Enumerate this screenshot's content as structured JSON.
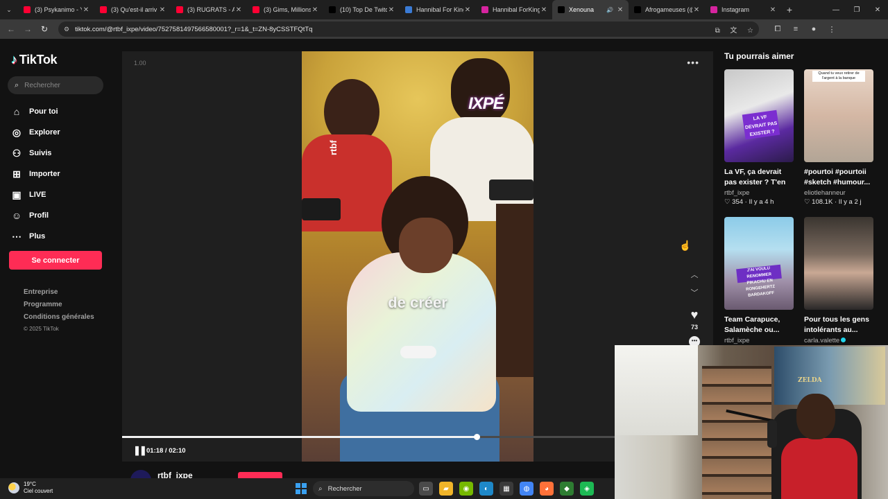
{
  "browser": {
    "tabs": [
      {
        "label": "(3) Psykanimo - Y",
        "icon": "youtube-icon",
        "color": "#ff0033"
      },
      {
        "label": "(3) Qu'est-il arriv",
        "icon": "youtube-icon",
        "color": "#ff0033"
      },
      {
        "label": "(3) RUGRATS - A l",
        "icon": "youtube-icon",
        "color": "#ff0033"
      },
      {
        "label": "(3) Gims, Millions",
        "icon": "youtube-icon",
        "color": "#ff0033"
      },
      {
        "label": "(10) Top De Twitc",
        "icon": "x-icon",
        "color": "#000000"
      },
      {
        "label": "Hannibal For King",
        "icon": "bookmark-icon",
        "color": "#3a7bd5"
      },
      {
        "label": "Hannibal ForKing",
        "icon": "instagram-icon",
        "color": "#d6249f"
      },
      {
        "label": "Xenouna",
        "icon": "tiktok-icon",
        "color": "#000000",
        "active": true
      },
      {
        "label": "Afrogameuses (@",
        "icon": "tiktok-icon",
        "color": "#000000"
      },
      {
        "label": "Instagram",
        "icon": "instagram-icon",
        "color": "#d6249f"
      }
    ],
    "new_tab": "+",
    "url": "tiktok.com/@rtbf_ixpe/video/7527581497566580001?_r=1&_t=ZN-8yCSSTFQtTq"
  },
  "sidebar": {
    "logo": "TikTok",
    "search_placeholder": "Rechercher",
    "nav": [
      {
        "label": "Pour toi",
        "icon": "home-icon"
      },
      {
        "label": "Explorer",
        "icon": "compass-icon"
      },
      {
        "label": "Suivis",
        "icon": "following-icon"
      },
      {
        "label": "Importer",
        "icon": "upload-icon"
      },
      {
        "label": "LIVE",
        "icon": "live-icon"
      },
      {
        "label": "Profil",
        "icon": "profile-icon"
      },
      {
        "label": "Plus",
        "icon": "more-icon"
      }
    ],
    "login_label": "Se connecter",
    "footer": [
      "Entreprise",
      "Programme",
      "Conditions générales"
    ],
    "copyright": "© 2025 TikTok"
  },
  "player": {
    "speed": "1.00",
    "caption": "de créer",
    "watermark_left": "rtbf",
    "watermark_right": "IXPÉ",
    "time": "01:18 / 02:10",
    "progress": 0.6,
    "likes": "73",
    "author": "rtbf_ixpe"
  },
  "suggestions": {
    "title": "Tu pourrais aimer",
    "cards": [
      {
        "title": "La VF, ça devrait pas exister ? T'en pens...",
        "author": "rtbf_ixpe",
        "likes": "354",
        "age": "Il y a 4 h",
        "overlay": "LA VF DEVRAIT PAS EXISTER ?"
      },
      {
        "title": "#pourtoi #pourtoii #sketch #humour...",
        "author": "eliotlehanneur",
        "likes": "108.1K",
        "age": "Il y a 2 j",
        "overlay": "Quand tu veux retirer de l'argent à la banque"
      },
      {
        "title": "Team Carapuce, Salamèche ou...",
        "author": "rtbf_ixpe",
        "overlay": "J'AI VOULU RENOMMER PIKACHU EN RONGEHERTZ BARDAKOFF"
      },
      {
        "title": "Pour tous les gens intolérants au...",
        "author": "carla.valette",
        "verified": true
      }
    ]
  },
  "webcam": {
    "poster_text": "ZELDA"
  },
  "taskbar": {
    "temperature": "19°C",
    "weather": "Ciel couvert",
    "search_placeholder": "Rechercher",
    "apps": [
      {
        "icon": "task-view-icon",
        "color": "#4a4a4a"
      },
      {
        "icon": "file-explorer-icon",
        "color": "#f0b429"
      },
      {
        "icon": "nvidia-icon",
        "color": "#76b900"
      },
      {
        "icon": "edge-icon",
        "color": "#1e88c8"
      },
      {
        "icon": "store-icon",
        "color": "#3a3a3a"
      },
      {
        "icon": "chrome-icon",
        "color": "#4285f4"
      },
      {
        "icon": "firefox-icon",
        "color": "#ff7139"
      },
      {
        "icon": "app-icon",
        "color": "#2e7d32"
      },
      {
        "icon": "app2-icon",
        "color": "#1db954"
      }
    ]
  }
}
